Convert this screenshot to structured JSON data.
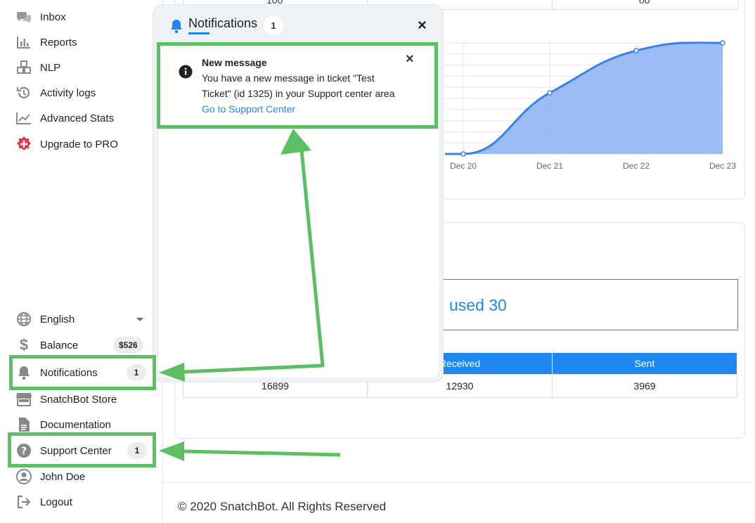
{
  "sidebar": {
    "items": [
      {
        "label": "Inbox",
        "icon": "chat-icon"
      },
      {
        "label": "Reports",
        "icon": "bar-chart-icon"
      },
      {
        "label": "NLP",
        "icon": "cubes-icon"
      },
      {
        "label": "Activity logs",
        "icon": "history-icon"
      },
      {
        "label": "Advanced Stats",
        "icon": "trend-chart-icon"
      },
      {
        "label": "Upgrade to PRO",
        "icon": "plus-circle-icon"
      }
    ],
    "language": "English",
    "balance_label": "Balance",
    "balance_value": "$526",
    "notifications_label": "Notifications",
    "notifications_count": "1",
    "store_label": "SnatchBot Store",
    "docs_label": "Documentation",
    "support_label": "Support Center",
    "support_count": "1",
    "user_name": "John Doe",
    "logout_label": "Logout"
  },
  "main": {
    "top_table_partial": {
      "left": "100",
      "right": "00"
    },
    "used_text": "used 30",
    "table": {
      "headers": [
        "",
        "Received",
        "Sent"
      ],
      "row": [
        "16899",
        "12930",
        "3969"
      ]
    },
    "footer": "© 2020 SnatchBot. All Rights Reserved"
  },
  "chart_data": {
    "type": "area",
    "x": [
      "Dec 20",
      "Dec 21",
      "Dec 22",
      "Dec 23"
    ],
    "tick_labels": [
      "Dec 20",
      "Dec 21",
      "Dec 22",
      "Dec 23"
    ],
    "values": [
      0,
      55,
      93,
      100
    ],
    "title": "",
    "xlabel": "",
    "ylabel": "",
    "grid": true,
    "color": "#3b82e6",
    "fill": "#8fb4f2"
  },
  "notifications_panel": {
    "title": "Notifications",
    "count": "1",
    "close": "×",
    "item": {
      "title": "New message",
      "body_line1": "You have a new message in ticket \"Test",
      "body_line2": "Ticket\" (id 1325) in your Support center area",
      "link": "Go to Support Center",
      "close": "×"
    }
  },
  "colors": {
    "accent": "#1e88f0",
    "highlight": "#5cbf63",
    "pro_red": "#e8384f"
  }
}
